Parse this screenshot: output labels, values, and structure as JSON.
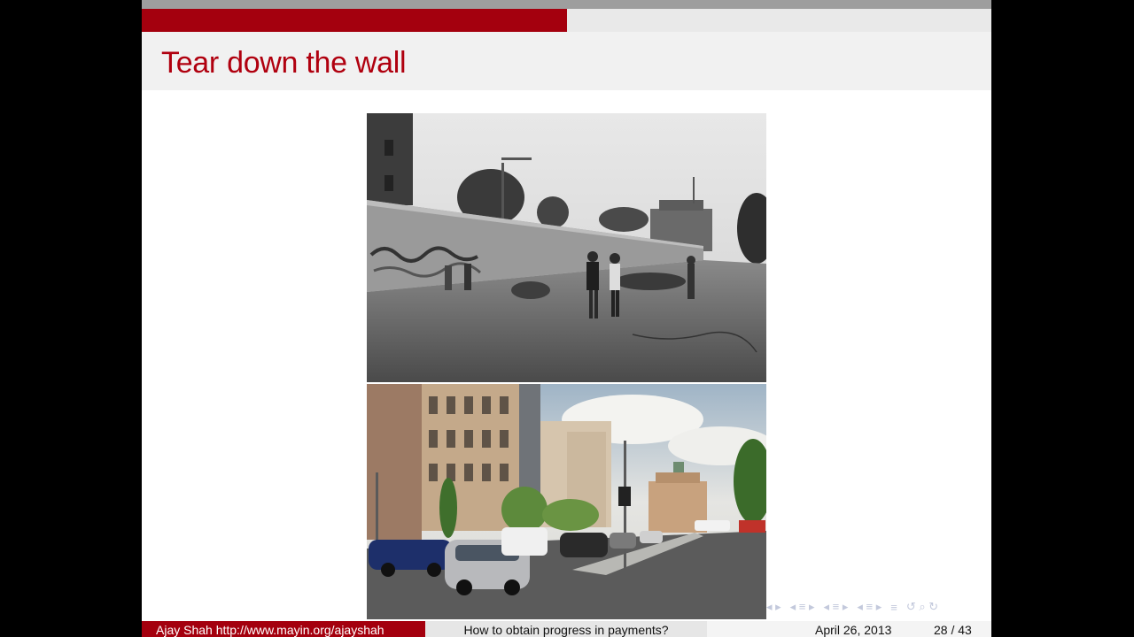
{
  "slide": {
    "title": "Tear down the wall",
    "progress_fraction": 0.5
  },
  "footer": {
    "author": "Ajay Shah http://www.mayin.org/ajayshah",
    "talk_title": "How to obtain progress in payments?",
    "date": "April 26, 2013",
    "page": "28 / 43"
  },
  "nav_icons": [
    "frame-prev-icon",
    "frame-next-icon",
    "section-prev-icon",
    "section-next-icon",
    "subsection-prev-icon",
    "subsection-next-icon",
    "align-icon",
    "search-icon",
    "back-icon"
  ],
  "colors": {
    "accent": "#a4000e",
    "title": "#b0000f"
  }
}
